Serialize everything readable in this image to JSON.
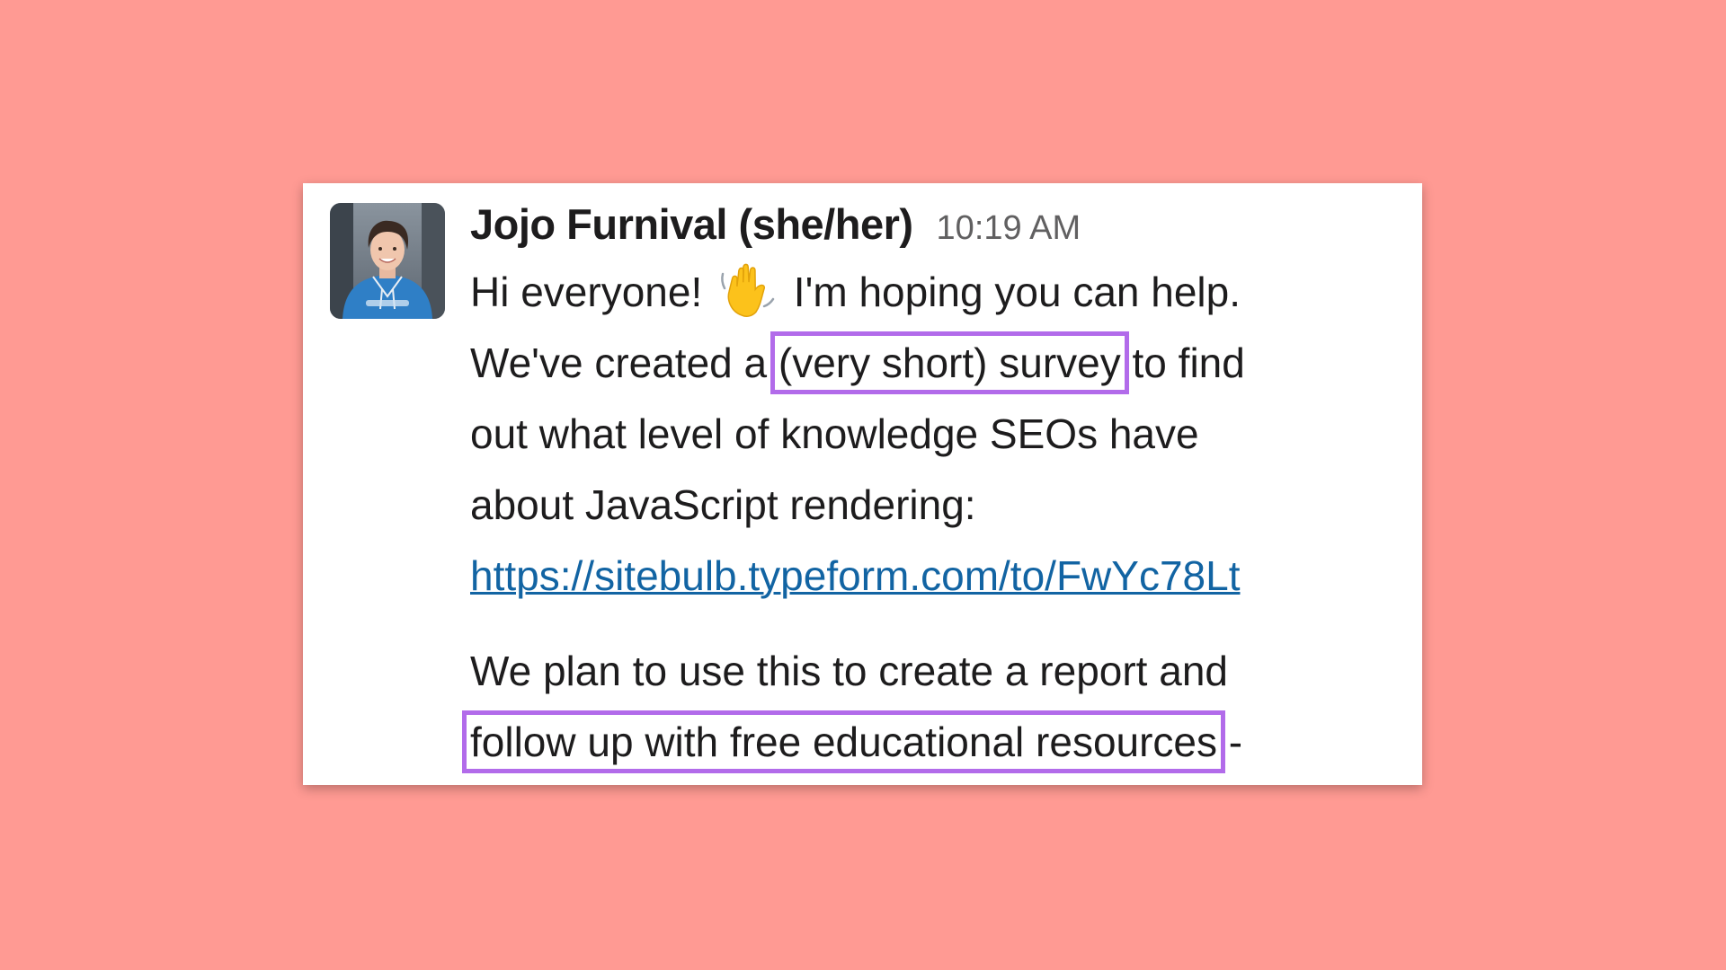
{
  "message": {
    "author": "Jojo Furnival (she/her)",
    "timestamp": "10:19 AM",
    "avatar_icon": "user-avatar-photo",
    "emoji_icon": "waving-hand-emoji",
    "lines": {
      "l1_before": "Hi everyone! ",
      "l1_after": " I'm hoping you can help.",
      "l2_before": "We've created a ",
      "l2_highlight": "(very short) survey",
      "l2_after": " to find",
      "l3": "out what level of knowledge SEOs have",
      "l4": "about JavaScript rendering:",
      "link": "https://sitebulb.typeform.com/to/FwYc78Lt",
      "l6": "We plan to use this to create a report and",
      "l7_highlight": "follow up with free educational resources",
      "l7_after": " -"
    }
  },
  "colors": {
    "background": "#ff9a93",
    "highlight_border": "#b26bea",
    "link": "#1264a3"
  }
}
